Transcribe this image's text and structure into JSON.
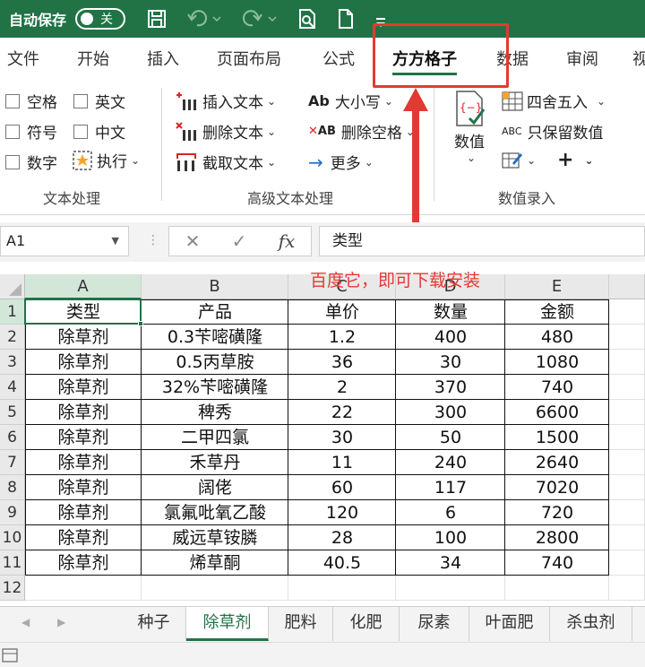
{
  "titlebar": {
    "autosave_label": "自动保存",
    "autosave_state": "关",
    "bg": "#217346"
  },
  "tabs": [
    {
      "label": "文件"
    },
    {
      "label": "开始"
    },
    {
      "label": "插入"
    },
    {
      "label": "页面布局"
    },
    {
      "label": "公式"
    },
    {
      "label": "方方格子",
      "active": true
    },
    {
      "label": "数据"
    },
    {
      "label": "审阅"
    },
    {
      "label": "视"
    }
  ],
  "ribbon": {
    "text_group": {
      "label": "文本处理",
      "checks": [
        "空格",
        "英文",
        "符号",
        "中文",
        "数字"
      ],
      "execute": "执行"
    },
    "adv_group": {
      "label": "高级文本处理",
      "insert": "插入文本",
      "delete": "删除文本",
      "extract": "截取文本",
      "case": "大小写",
      "del_space": "删除空格",
      "more": "更多"
    },
    "num_group": {
      "label": "数值录入",
      "value": "数值",
      "round": "四舍五入",
      "keep_num": "只保留数值",
      "plus": "+"
    }
  },
  "formula_bar": {
    "namebox": "A1",
    "content": "类型",
    "fx": "fx"
  },
  "annotation": {
    "text": "百度它，即可下载安装",
    "color": "#e23a32"
  },
  "sheet": {
    "columns": [
      "A",
      "B",
      "C",
      "D",
      "E"
    ],
    "row_numbers": [
      "1",
      "2",
      "3",
      "4",
      "5",
      "6",
      "7",
      "8",
      "9",
      "10",
      "11",
      "12"
    ],
    "header": [
      "类型",
      "产品",
      "单价",
      "数量",
      "金额"
    ],
    "rows": [
      [
        "除草剂",
        "0.3苄嘧磺隆",
        "1.2",
        "400",
        "480"
      ],
      [
        "除草剂",
        "0.5丙草胺",
        "36",
        "30",
        "1080"
      ],
      [
        "除草剂",
        "32%苄嘧磺隆",
        "2",
        "370",
        "740"
      ],
      [
        "除草剂",
        "稗秀",
        "22",
        "300",
        "6600"
      ],
      [
        "除草剂",
        "二甲四氯",
        "30",
        "50",
        "1500"
      ],
      [
        "除草剂",
        "禾草丹",
        "11",
        "240",
        "2640"
      ],
      [
        "除草剂",
        "阔佬",
        "60",
        "117",
        "7020"
      ],
      [
        "除草剂",
        "氯氟吡氧乙酸",
        "120",
        "6",
        "720"
      ],
      [
        "除草剂",
        "威远草铵膦",
        "28",
        "100",
        "2800"
      ],
      [
        "除草剂",
        "烯草酮",
        "40.5",
        "34",
        "740"
      ]
    ]
  },
  "sheet_tabs": [
    {
      "label": "种子"
    },
    {
      "label": "除草剂",
      "active": true
    },
    {
      "label": "肥料"
    },
    {
      "label": "化肥"
    },
    {
      "label": "尿素"
    },
    {
      "label": "叶面肥"
    },
    {
      "label": "杀虫剂"
    }
  ]
}
